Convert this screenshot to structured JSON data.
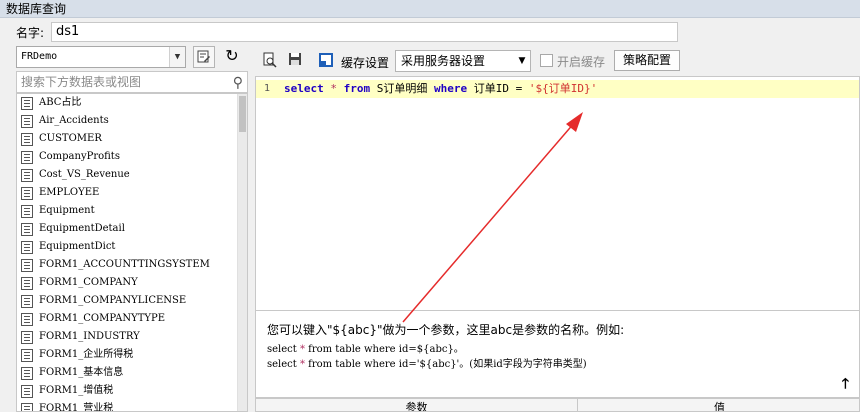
{
  "window": {
    "title": "数据库查询"
  },
  "name_field": {
    "label": "名字:",
    "value": "ds1"
  },
  "left": {
    "connection": "FRDemo",
    "search_placeholder": "搜索下方数据表或视图",
    "tables": [
      "ABC占比",
      "Air_Accidents",
      "CUSTOMER",
      "CompanyProfits",
      "Cost_VS_Revenue",
      "EMPLOYEE",
      "Equipment",
      "EquipmentDetail",
      "EquipmentDict",
      "FORM1_ACCOUNTTINGSYSTEM",
      "FORM1_COMPANY",
      "FORM1_COMPANYLICENSE",
      "FORM1_COMPANYTYPE",
      "FORM1_INDUSTRY",
      "FORM1_企业所得税",
      "FORM1_基本信息",
      "FORM1_增值税",
      "FORM1_营业税"
    ]
  },
  "toolbar": {
    "cache_label": "缓存设置",
    "cache_value": "采用服务器设置",
    "enable_cache_label": "开启缓存",
    "strategy_button": "策略配置"
  },
  "editor": {
    "line_number": "1",
    "kw_select": "select",
    "star": "*",
    "kw_from": "from",
    "table": "S订单明细",
    "kw_where": "where",
    "field": "订单ID",
    "eq": "=",
    "param": "'${订单ID}'"
  },
  "hint": {
    "main": "您可以键入\"${abc}\"做为一个参数，这里abc是参数的名称。例如:",
    "example1_pre": "select ",
    "example1_star": "*",
    "example1_post": " from table where id=${abc}。",
    "example2_pre": "select ",
    "example2_star": "*",
    "example2_post": " from table where id='${abc}'。(如果id字段为字符串类型)"
  },
  "params_table": {
    "col_param": "参数",
    "col_value": "值"
  },
  "colors": {
    "keyword": "#1f00c4",
    "string": "#d0302f",
    "annotation_arrow": "#e52b2b",
    "line_highlight": "#ffffc4"
  }
}
